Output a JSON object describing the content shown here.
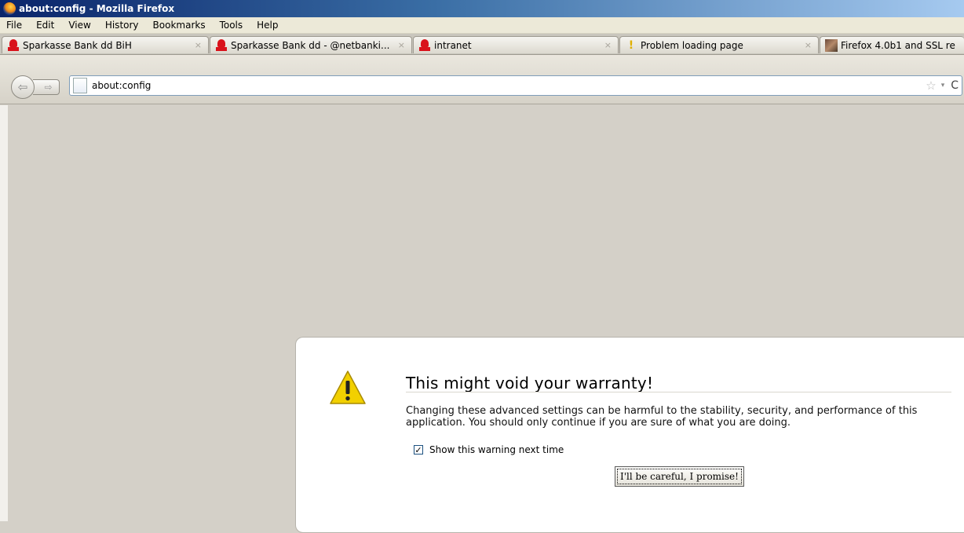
{
  "window": {
    "title": "about:config - Mozilla Firefox"
  },
  "menu": [
    "File",
    "Edit",
    "View",
    "History",
    "Bookmarks",
    "Tools",
    "Help"
  ],
  "tabs": [
    {
      "label": "Sparkasse Bank dd BiH",
      "icon": "sparkasse-icon"
    },
    {
      "label": "Sparkasse Bank dd - @netbanki...",
      "icon": "sparkasse-icon"
    },
    {
      "label": "intranet",
      "icon": "sparkasse-icon"
    },
    {
      "label": "Problem loading page",
      "icon": "warning-icon"
    },
    {
      "label": "Firefox 4.0b1 and SSL re",
      "icon": "image-icon"
    }
  ],
  "tab_close": "×",
  "navigation": {
    "back": "⇦",
    "forward": "⇨",
    "url": "about:config",
    "star": "☆",
    "dropdown": "▾",
    "reload": "C"
  },
  "warning": {
    "title": "This might void your warranty!",
    "body": "Changing these advanced settings can be harmful to the stability, security, and performance of this application. You should only continue if you are sure of what you are doing.",
    "checkbox_label": "Show this warning next time",
    "checkbox_checked": true,
    "checkbox_mark": "✓",
    "button_label": "I'll be careful, I promise!"
  },
  "colors": {
    "titlebar": "#0a246a",
    "warning_icon": "#f2d000",
    "sparkasse_red": "#d9121b"
  }
}
